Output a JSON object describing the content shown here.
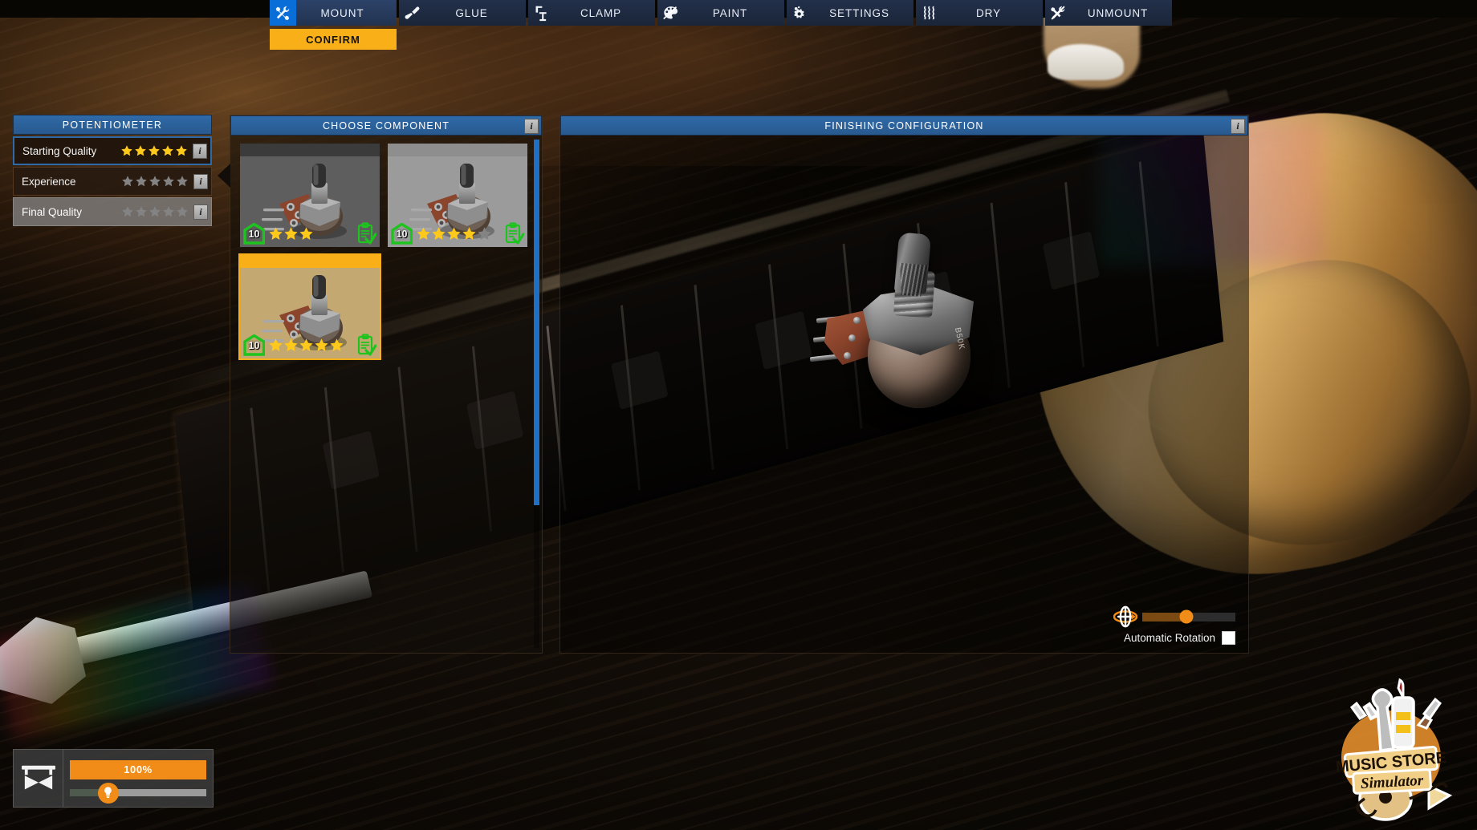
{
  "toolbar": {
    "tabs": [
      {
        "label": "MOUNT",
        "icon": "wrench-screwdriver-icon",
        "active": true
      },
      {
        "label": "GLUE",
        "icon": "glue-bottle-icon",
        "active": false
      },
      {
        "label": "CLAMP",
        "icon": "clamp-icon",
        "active": false
      },
      {
        "label": "PAINT",
        "icon": "paint-palette-icon",
        "active": false
      },
      {
        "label": "SETTINGS",
        "icon": "gear-icon",
        "active": false
      },
      {
        "label": "DRY",
        "icon": "heat-waves-icon",
        "active": false
      },
      {
        "label": "UNMOUNT",
        "icon": "unmount-icon",
        "active": false
      }
    ],
    "confirm_label": "CONFIRM"
  },
  "stats_panel": {
    "title": "POTENTIOMETER",
    "rows": [
      {
        "label": "Starting Quality",
        "stars_filled": 5,
        "stars_total": 5,
        "info": "i"
      },
      {
        "label": "Experience",
        "stars_filled": 0,
        "stars_total": 5,
        "info": "i"
      },
      {
        "label": "Final Quality",
        "stars_filled": 0,
        "stars_total": 5,
        "info": "i"
      }
    ]
  },
  "component_panel": {
    "title": "CHOOSE COMPONENT",
    "info": "i",
    "items": [
      {
        "level": "10",
        "stars_filled": 3,
        "stars_total": 3,
        "selected": false,
        "owned_icon": "clipboard-check-icon",
        "thumb": "potentiometer-thumbnail"
      },
      {
        "level": "10",
        "stars_filled": 4,
        "stars_total": 5,
        "selected": false,
        "owned_icon": "clipboard-check-icon",
        "thumb": "potentiometer-thumbnail"
      },
      {
        "level": "10",
        "stars_filled": 5,
        "stars_total": 5,
        "selected": true,
        "owned_icon": "clipboard-check-icon",
        "thumb": "potentiometer-thumbnail"
      }
    ]
  },
  "viewport_panel": {
    "title": "FINISHING CONFIGURATION",
    "info": "i",
    "model_label": "B50K",
    "rotation": {
      "icon": "rotate-object-icon",
      "slider_value": 47,
      "auto_label": "Automatic Rotation",
      "auto_checked": false
    }
  },
  "bench_widget": {
    "icon": "workbench-icon",
    "progress_label": "100%",
    "progress_value": 100,
    "light_icon": "lightbulb-icon",
    "light_value": 28
  },
  "logo": {
    "line1": "MUSIC STORE",
    "line2": "Simulator"
  },
  "colors": {
    "accent_orange": "#f9b018",
    "panel_blue": "#2f6aa8",
    "active_blue": "#0a6ed8",
    "star_gold": "#ffc91b",
    "star_off": "#838383",
    "badge_green": "#1ec41e"
  }
}
